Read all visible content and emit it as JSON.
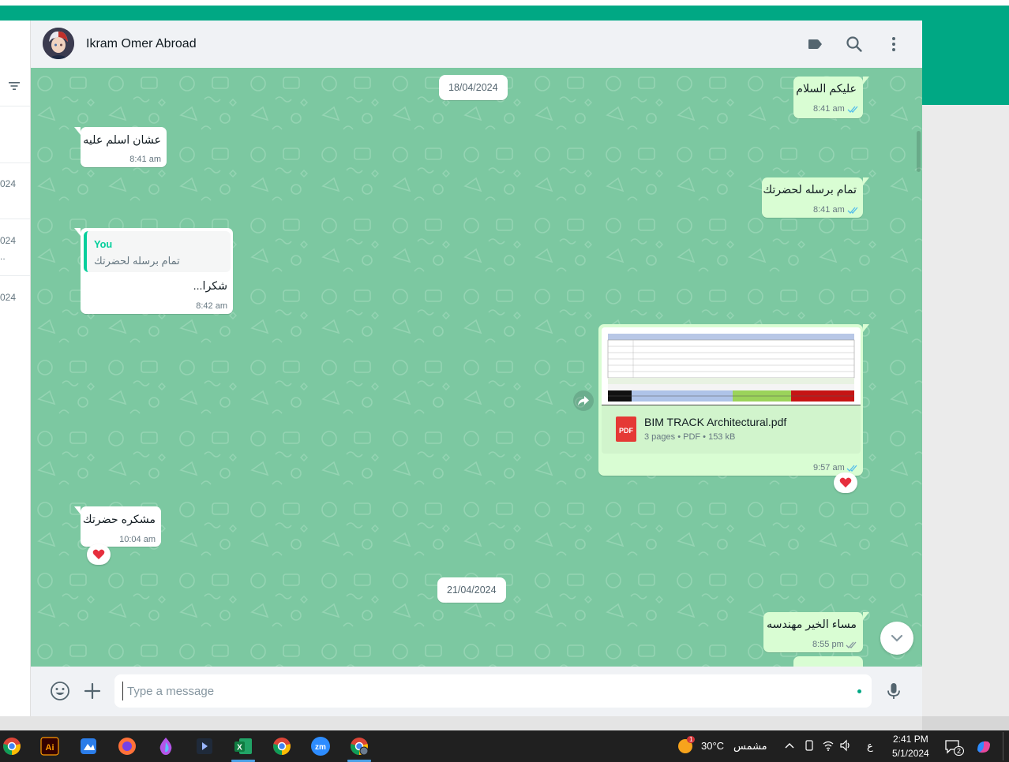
{
  "header": {
    "contact_name": "Ikram Omer Abroad"
  },
  "left_panel": {
    "dates": [
      "024",
      "024",
      "024"
    ],
    "ellipsis": ".."
  },
  "dates": {
    "first": "18/04/2024",
    "second": "21/04/2024"
  },
  "messages": [
    {
      "dir": "out",
      "text": "عليكم السلام",
      "time": "8:41 am"
    },
    {
      "dir": "in",
      "text": "عشان اسلم عليه",
      "time": "8:41 am"
    },
    {
      "dir": "out",
      "text": "تمام برسله لحضرتك",
      "time": "8:41 am"
    },
    {
      "dir": "in",
      "quote_author": "You",
      "quote_text": "تمام برسله لحضرتك",
      "text": "شكرا...",
      "time": "8:42 am"
    },
    {
      "dir": "out",
      "type": "document",
      "file_name": "BIM TRACK Architectural.pdf",
      "file_meta": "3 pages • PDF • 153 kB",
      "badge": "PDF",
      "time": "9:57 am",
      "reaction": "heart"
    },
    {
      "dir": "in",
      "text": "مشكره حضرتك",
      "time": "10:04 am",
      "reaction": "heart"
    },
    {
      "dir": "out",
      "text": "مساء الخير مهندسه",
      "time": "8:55 pm"
    }
  ],
  "composer": {
    "placeholder": "Type a message"
  },
  "taskbar": {
    "weather_temp": "30°C",
    "weather_text": "مشمس",
    "weather_badge": "1",
    "lang": "ع",
    "time": "2:41 PM",
    "date": "5/1/2024",
    "notif_count": "2",
    "apps": [
      "chrome-profile-icon",
      "illustrator-icon",
      "paint-icon",
      "firefox-icon",
      "drop-icon",
      "premiere-icon",
      "excel-icon",
      "chrome-icon",
      "zoom-icon",
      "chrome-profile-2-icon"
    ]
  },
  "colors": {
    "accent": "#00a884",
    "chat_bg": "#7cc8a1",
    "outgoing": "#d9fdd3",
    "incoming": "#ffffff",
    "tick": "#53bdeb"
  }
}
